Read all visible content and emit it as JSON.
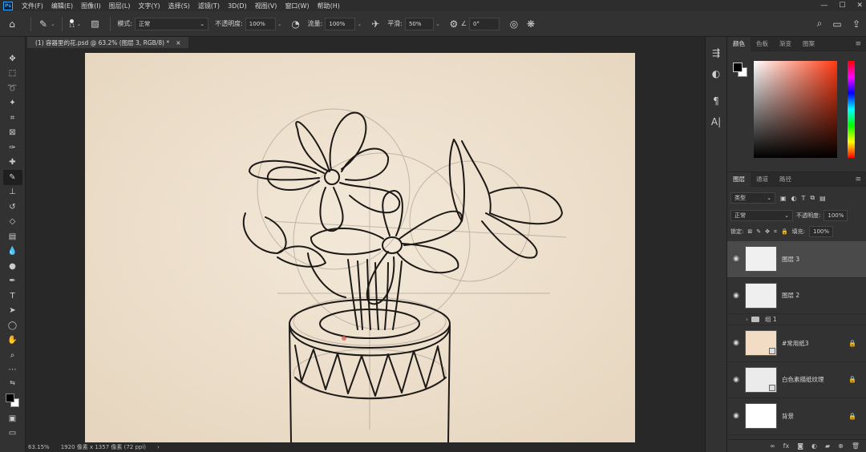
{
  "app": {
    "logo": "Ps"
  },
  "menu": [
    "文件(F)",
    "编辑(E)",
    "图像(I)",
    "图层(L)",
    "文字(Y)",
    "选择(S)",
    "滤镜(T)",
    "3D(D)",
    "视图(V)",
    "窗口(W)",
    "帮助(H)"
  ],
  "options": {
    "brush_size": "11",
    "mode_label": "模式:",
    "mode_value": "正常",
    "opacity_label": "不透明度:",
    "opacity_value": "100%",
    "flow_label": "流量:",
    "flow_value": "100%",
    "smooth_label": "平滑:",
    "smooth_value": "50%",
    "angle_value": "0°"
  },
  "document": {
    "tab_title": "(1) 容器里的花.psd @ 63.2% (图层 3, RGB/8) *",
    "zoom": "63.15%",
    "dimensions": "1920 像素 x 1357 像素 (72 ppi)"
  },
  "color_panel": {
    "tabs": [
      "颜色",
      "色板",
      "渐变",
      "图案"
    ],
    "fg_color": "#000000",
    "bg_color": "#ffffff"
  },
  "layers_panel": {
    "tabs": [
      "图层",
      "通道",
      "路径"
    ],
    "filter_kind": "类型",
    "blend_mode": "正常",
    "opacity_label": "不透明度:",
    "opacity_value": "100%",
    "lock_label": "锁定:",
    "fill_label": "填充:",
    "fill_value": "100%",
    "layers": [
      {
        "name": "图层 3",
        "selected": true
      },
      {
        "name": "图层 2",
        "selected": false
      },
      {
        "name": "组 1",
        "type": "group"
      },
      {
        "name": "#常用纸3",
        "locked": true
      },
      {
        "name": "白色素描纸纹理",
        "locked": true
      },
      {
        "name": "背景",
        "locked": true
      }
    ]
  }
}
